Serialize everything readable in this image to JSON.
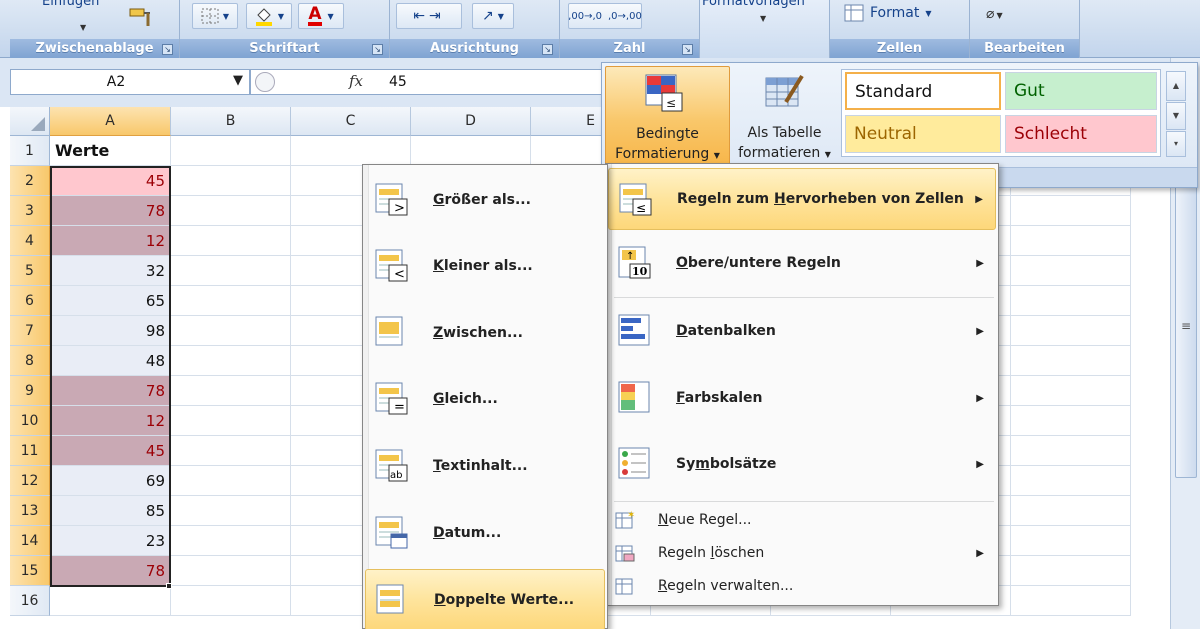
{
  "ribbon": {
    "groups": {
      "clipboard": "Zwischenablage",
      "font": "Schriftart",
      "alignment": "Ausrichtung",
      "number": "Zahl",
      "styles": "Formatvorlagen",
      "cells": "Zellen",
      "editing": "Bearbeiten"
    },
    "paste_label": "Einfügen",
    "format_label": "Format",
    "number_buttons": [
      ",00→,0",
      ",0→,00"
    ]
  },
  "formula_bar": {
    "name_box": "A2",
    "fx": "fx",
    "value": "45"
  },
  "columns": [
    "A",
    "B",
    "C",
    "D",
    "E"
  ],
  "rows": [
    {
      "n": "1",
      "a": "Werte",
      "kind": "header"
    },
    {
      "n": "2",
      "a": "45",
      "kind": "pink"
    },
    {
      "n": "3",
      "a": "78",
      "kind": "dup"
    },
    {
      "n": "4",
      "a": "12",
      "kind": "dup"
    },
    {
      "n": "5",
      "a": "32",
      "kind": "plain"
    },
    {
      "n": "6",
      "a": "65",
      "kind": "plain"
    },
    {
      "n": "7",
      "a": "98",
      "kind": "plain"
    },
    {
      "n": "8",
      "a": "48",
      "kind": "plain"
    },
    {
      "n": "9",
      "a": "78",
      "kind": "dup"
    },
    {
      "n": "10",
      "a": "12",
      "kind": "dup"
    },
    {
      "n": "11",
      "a": "45",
      "kind": "dup"
    },
    {
      "n": "12",
      "a": "69",
      "kind": "plain"
    },
    {
      "n": "13",
      "a": "85",
      "kind": "plain"
    },
    {
      "n": "14",
      "a": "23",
      "kind": "plain"
    },
    {
      "n": "15",
      "a": "78",
      "kind": "dup"
    },
    {
      "n": "16",
      "a": "",
      "kind": "empty"
    }
  ],
  "styles_gallery": {
    "conditional_formatting": [
      "Bedingte",
      "Formatierung"
    ],
    "format_as_table": [
      "Als Tabelle",
      "formatieren"
    ],
    "cell_styles": [
      {
        "label": "Standard",
        "bg": "#ffffff",
        "fg": "#000000"
      },
      {
        "label": "Gut",
        "bg": "#c6efce",
        "fg": "#006100"
      },
      {
        "label": "Neutral",
        "bg": "#ffeb9c",
        "fg": "#9c6500"
      },
      {
        "label": "Schlecht",
        "bg": "#ffc7ce",
        "fg": "#9c0006"
      }
    ]
  },
  "cf_menu": {
    "items": [
      {
        "pre": "Regeln zum ",
        "key": "H",
        "post": "ervorheben von Zellen",
        "submenu": true,
        "highlighted": true,
        "icon": "highlight-rules-icon"
      },
      {
        "pre": "",
        "key": "O",
        "post": "bere/untere Regeln",
        "submenu": true,
        "icon": "top-bottom-rules-icon"
      },
      {
        "pre": "",
        "key": "D",
        "post": "atenbalken",
        "submenu": true,
        "icon": "data-bars-icon"
      },
      {
        "pre": "",
        "key": "F",
        "post": "arbskalen",
        "submenu": true,
        "icon": "color-scales-icon"
      },
      {
        "pre": "Sy",
        "key": "m",
        "post": "bolsätze",
        "submenu": true,
        "icon": "icon-sets-icon"
      },
      {
        "pre": "",
        "key": "N",
        "post": "eue Regel...",
        "submenu": false,
        "icon": "new-rule-icon"
      },
      {
        "pre": "Regeln ",
        "key": "l",
        "post": "öschen",
        "submenu": true,
        "icon": "clear-rules-icon"
      },
      {
        "pre": "",
        "key": "R",
        "post": "egeln verwalten...",
        "submenu": false,
        "icon": "manage-rules-icon"
      }
    ]
  },
  "highlight_submenu": {
    "items": [
      {
        "pre": "",
        "key": "G",
        "post": "rößer als...",
        "icon": "greater-than-icon",
        "sym": ">"
      },
      {
        "pre": "",
        "key": "K",
        "post": "leiner als...",
        "icon": "less-than-icon",
        "sym": "<"
      },
      {
        "pre": "",
        "key": "Z",
        "post": "wischen...",
        "icon": "between-icon",
        "sym": ""
      },
      {
        "pre": "",
        "key": "G",
        "post": "leich...",
        "icon": "equal-to-icon",
        "sym": "="
      },
      {
        "pre": "",
        "key": "T",
        "post": "extinhalt...",
        "icon": "text-contains-icon",
        "sym": "ab"
      },
      {
        "pre": "",
        "key": "D",
        "post": "atum...",
        "icon": "date-occurring-icon",
        "sym": ""
      },
      {
        "pre": "",
        "key": "D",
        "post": "oppelte Werte...",
        "icon": "duplicate-values-icon",
        "sym": "",
        "highlighted": true
      }
    ]
  },
  "colors": {
    "pink_fill": "#ffc7ce",
    "duplicate_fill": "#c9a9b4",
    "plain_fill": "#e9edf6",
    "highlight_text": "#9c0006",
    "selection_orange": "#f8c86b"
  }
}
